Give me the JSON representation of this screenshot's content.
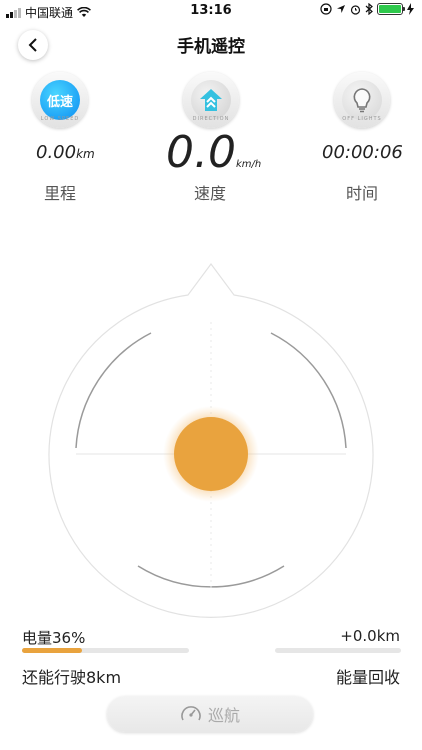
{
  "status_bar": {
    "carrier": "中国联通",
    "time": "13:16",
    "battery_color": "#2ec94c"
  },
  "nav": {
    "back_icon": "chevron-left-icon",
    "title": "手机遥控"
  },
  "modes": {
    "speed": {
      "label": "低速",
      "sub": "LOW SPEED",
      "color": "#0c8cf2"
    },
    "direction": {
      "sub": "DIRECTION",
      "icon": "direction-icon"
    },
    "lights": {
      "sub": "OFF LIGHTS",
      "icon": "bulb-icon"
    }
  },
  "stats": {
    "mileage": {
      "value": "0.00",
      "unit": "km",
      "label": "里程"
    },
    "speed": {
      "value": "0.0",
      "unit": "km/h",
      "label": "速度"
    },
    "time": {
      "value": "00:00:06",
      "label": "时间"
    }
  },
  "joystick": {
    "knob_color": "#e9a33e"
  },
  "battery": {
    "label": "电量36%",
    "level_percent": 36,
    "range_text": "还能行驶8km"
  },
  "energy": {
    "value": "+0.0km",
    "level_percent": 0,
    "label": "能量回收"
  },
  "cruise": {
    "label": "巡航",
    "icon": "speedometer-icon"
  }
}
